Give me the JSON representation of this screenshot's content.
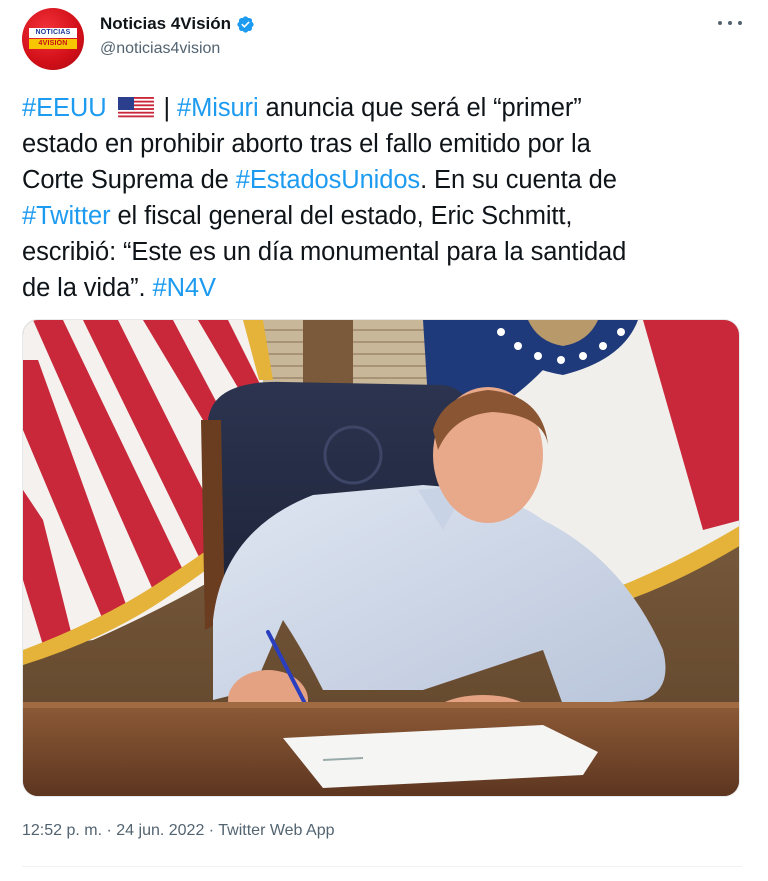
{
  "account": {
    "display_name": "Noticias 4Visión",
    "handle": "@noticias4vision",
    "verified": true,
    "avatar_logo_top": "NOTICIAS",
    "avatar_logo_bottom": "4VISIÓN"
  },
  "icons": {
    "verified": "verified-badge-icon",
    "more": "more-options-icon",
    "flag": "us-flag-emoji"
  },
  "tweet": {
    "lines": [
      [
        {
          "text": "#EEUU",
          "type": "hashtag"
        },
        {
          "text": " ",
          "type": "text"
        },
        {
          "text": "",
          "type": "flag"
        },
        {
          "text": " | ",
          "type": "text"
        },
        {
          "text": "#Misuri",
          "type": "hashtag"
        },
        {
          "text": " anuncia que será el “primer”",
          "type": "text"
        }
      ],
      [
        {
          "text": "estado en prohibir aborto tras el fallo emitido por la",
          "type": "text"
        }
      ],
      [
        {
          "text": "Corte Suprema de ",
          "type": "text"
        },
        {
          "text": "#EstadosUnidos",
          "type": "hashtag"
        },
        {
          "text": ". En su cuenta de",
          "type": "text"
        }
      ],
      [
        {
          "text": "#Twitter",
          "type": "hashtag"
        },
        {
          "text": " el fiscal general del estado, Eric Schmitt,",
          "type": "text"
        }
      ],
      [
        {
          "text": "escribió: “Este es un día monumental para la santidad",
          "type": "text"
        }
      ],
      [
        {
          "text": "de la vida”. ",
          "type": "text"
        },
        {
          "text": "#N4V",
          "type": "hashtag"
        }
      ]
    ]
  },
  "meta": {
    "time": "12:52 p. m.",
    "separator": " · ",
    "date": "24 jun. 2022",
    "source": "Twitter Web App"
  },
  "colors": {
    "hashtag": "#1d9bf0",
    "secondary_text": "#536471",
    "primary_text": "#0f1419",
    "verified_badge": "#1d9bf0",
    "avatar_red": "#d10f18"
  }
}
